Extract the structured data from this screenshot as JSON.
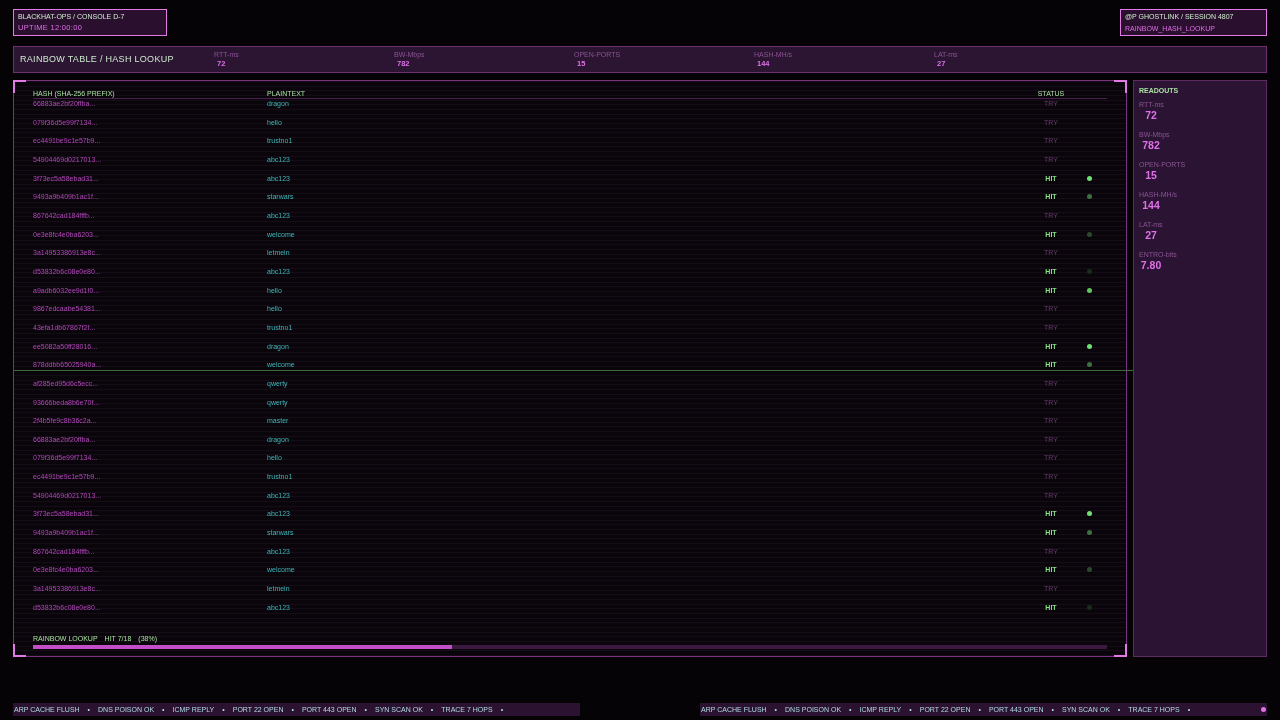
{
  "console": {
    "title": "BLACKHAT-OPS / CONSOLE D-7",
    "uptime": "UPTIME 12:00:00"
  },
  "session": {
    "title": "@P GHOSTLINK / SESSION 4807",
    "module": "RAINBOW_HASH_LOOKUP"
  },
  "header": {
    "title": "RAINBOW TABLE / HASH LOOKUP",
    "metrics": [
      {
        "label": "RTT-ms",
        "value": "72"
      },
      {
        "label": "BW-Mbps",
        "value": "782"
      },
      {
        "label": "OPEN-PORTS",
        "value": "15"
      },
      {
        "label": "HASH-MH/s",
        "value": "144"
      },
      {
        "label": "LAT-ms",
        "value": "27"
      }
    ]
  },
  "table": {
    "columns": [
      "HASH (SHA-256 PREFIX)",
      "PLAINTEXT",
      "STATUS"
    ],
    "rows": [
      {
        "hash": "66883ae2bf20ffba...",
        "plaintext": "dragon",
        "status": "TRY",
        "kind": "try"
      },
      {
        "hash": "079f36d5e99f7134...",
        "plaintext": "hello",
        "status": "TRY",
        "kind": "try"
      },
      {
        "hash": "ec4491be9c1e57b9...",
        "plaintext": "trustno1",
        "status": "TRY",
        "kind": "try"
      },
      {
        "hash": "54904469d0217013...",
        "plaintext": "abc123",
        "status": "TRY",
        "kind": "try"
      },
      {
        "hash": "3f73ec5a58ebad31...",
        "plaintext": "abc123",
        "status": "HIT",
        "kind": "hit",
        "color": "#72e072"
      },
      {
        "hash": "9493a9b409b1ac1f...",
        "plaintext": "starwars",
        "status": "HIT",
        "kind": "hit",
        "color": "#3f6f3f"
      },
      {
        "hash": "867642cad184fffb...",
        "plaintext": "abc123",
        "status": "TRY",
        "kind": "try"
      },
      {
        "hash": "0e3e8fc4e0ba6203...",
        "plaintext": "welcome",
        "status": "HIT",
        "kind": "hit",
        "color": "#2b4a2b"
      },
      {
        "hash": "3a14953386913e8c...",
        "plaintext": "letmein",
        "status": "TRY",
        "kind": "try"
      },
      {
        "hash": "d53832b6c08e0e80...",
        "plaintext": "abc123",
        "status": "HIT",
        "kind": "hit",
        "color": "#1c2c1c"
      },
      {
        "hash": "a9adb6032ee9d1f0...",
        "plaintext": "hello",
        "status": "HIT",
        "kind": "hit",
        "color": "#5ec85e"
      },
      {
        "hash": "9867edcaabe54381...",
        "plaintext": "hello",
        "status": "TRY",
        "kind": "try"
      },
      {
        "hash": "43efa1db67867f2f...",
        "plaintext": "trustno1",
        "status": "TRY",
        "kind": "try"
      },
      {
        "hash": "ee5082a50ff28016...",
        "plaintext": "dragon",
        "status": "HIT",
        "kind": "hit",
        "color": "#72e072"
      },
      {
        "hash": "878ddbb65025940a...",
        "plaintext": "welcome",
        "status": "HIT",
        "kind": "hit",
        "color": "#3f6f3f"
      },
      {
        "hash": "af285ed95d6c5ecc...",
        "plaintext": "qwerty",
        "status": "TRY",
        "kind": "try"
      },
      {
        "hash": "93666beda8b6e70f...",
        "plaintext": "qwerty",
        "status": "TRY",
        "kind": "try"
      },
      {
        "hash": "2f4b5fe9c8b36c2a...",
        "plaintext": "master",
        "status": "TRY",
        "kind": "try"
      },
      {
        "hash": "66883ae2bf20ffba...",
        "plaintext": "dragon",
        "status": "TRY",
        "kind": "try"
      },
      {
        "hash": "079f36d5e99f7134...",
        "plaintext": "hello",
        "status": "TRY",
        "kind": "try"
      },
      {
        "hash": "ec4491be9c1e57b9...",
        "plaintext": "trustno1",
        "status": "TRY",
        "kind": "try"
      },
      {
        "hash": "54904469d0217013...",
        "plaintext": "abc123",
        "status": "TRY",
        "kind": "try"
      },
      {
        "hash": "3f73ec5a58ebad31...",
        "plaintext": "abc123",
        "status": "HIT",
        "kind": "hit",
        "color": "#72e072"
      },
      {
        "hash": "9493a9b409b1ac1f...",
        "plaintext": "starwars",
        "status": "HIT",
        "kind": "hit",
        "color": "#3f6f3f"
      },
      {
        "hash": "867642cad184fffb...",
        "plaintext": "abc123",
        "status": "TRY",
        "kind": "try"
      },
      {
        "hash": "0e3e8fc4e0ba6203...",
        "plaintext": "welcome",
        "status": "HIT",
        "kind": "hit",
        "color": "#2b4a2b"
      },
      {
        "hash": "3a14953386913e8c...",
        "plaintext": "letmein",
        "status": "TRY",
        "kind": "try"
      },
      {
        "hash": "d53832b6c08e0e80...",
        "plaintext": "abc123",
        "status": "HIT",
        "kind": "hit",
        "color": "#1c2c1c"
      }
    ]
  },
  "progress": {
    "label": "RAINBOW LOOKUP",
    "count": "HIT 7/18",
    "percent": "(38%)",
    "level": 0.39
  },
  "readouts": {
    "title": "READOUTS",
    "items": [
      {
        "label": "RTT-ms",
        "value": "72"
      },
      {
        "label": "BW-Mbps",
        "value": "782"
      },
      {
        "label": "OPEN-PORTS",
        "value": "15"
      },
      {
        "label": "HASH-MH/s",
        "value": "144"
      },
      {
        "label": "LAT-ms",
        "value": "27"
      },
      {
        "label": "ENTRO-bits",
        "value": "7.80"
      }
    ]
  },
  "tickers": [
    {
      "items": [
        "ARP CACHE FLUSH",
        "DNS POISON OK",
        "ICMP REPLY",
        "PORT 22 OPEN",
        "PORT 443 OPEN",
        "SYN SCAN OK",
        "TRACE 7 HOPS"
      ],
      "separator": "•"
    },
    {
      "items": [
        "ARP CACHE FLUSH",
        "DNS POISON OK",
        "ICMP REPLY",
        "PORT 22 OPEN",
        "PORT 443 OPEN",
        "SYN SCAN OK",
        "TRACE 7 HOPS"
      ],
      "separator": "•"
    }
  ]
}
